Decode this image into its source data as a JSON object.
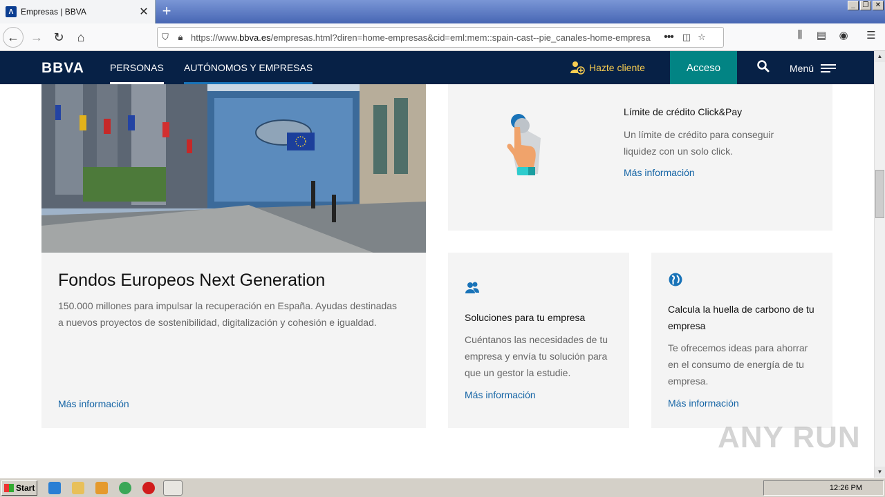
{
  "browser": {
    "tab_title": "Empresas | BBVA",
    "tab_close": "✕",
    "new_tab": "+",
    "url_prefix": "https://www.",
    "url_domain": "bbva.es",
    "url_rest": "/empresas.html?diren=home-empresas&cid=eml:mem::spain-cast--pie_canales-home-empresa",
    "page_actions": "•••"
  },
  "header": {
    "logo": "BBVA",
    "tabs": [
      "PERSONAS",
      "AUTÓNOMOS Y EMPRESAS"
    ],
    "hazte_cliente": "Hazte cliente",
    "acceso": "Acceso",
    "menu": "Menú"
  },
  "cards": {
    "fondos": {
      "title": "Fondos Europeos Next Generation",
      "description": "150.000 millones para impulsar la recuperación en España. Ayudas destinadas a nuevos proyectos de sostenibilidad, digitalización y cohesión e igualdad.",
      "link": "Más información"
    },
    "credito": {
      "title": "Límite de crédito Click&Pay",
      "description": "Un límite de crédito para conseguir liquidez con un solo click.",
      "link": "Más información"
    },
    "soluciones": {
      "title": "Soluciones para tu empresa",
      "description": "Cuéntanos las necesidades de tu empresa y envía tu solución para que un gestor la estudie.",
      "link": "Más información"
    },
    "huella": {
      "title": "Calcula la huella de carbono de tu empresa",
      "description": "Te ofrecemos ideas para ahorrar en el consumo de energía de tu empresa.",
      "link": "Más información"
    }
  },
  "watermark": "ANY RUN",
  "taskbar": {
    "start": "Start",
    "clock": "12:26 PM"
  },
  "colors": {
    "header_bg": "#072146",
    "acceso_bg": "#028484",
    "hazte_color": "#f8cd51",
    "link_color": "#1464a5",
    "card_bg": "#f4f4f4"
  }
}
